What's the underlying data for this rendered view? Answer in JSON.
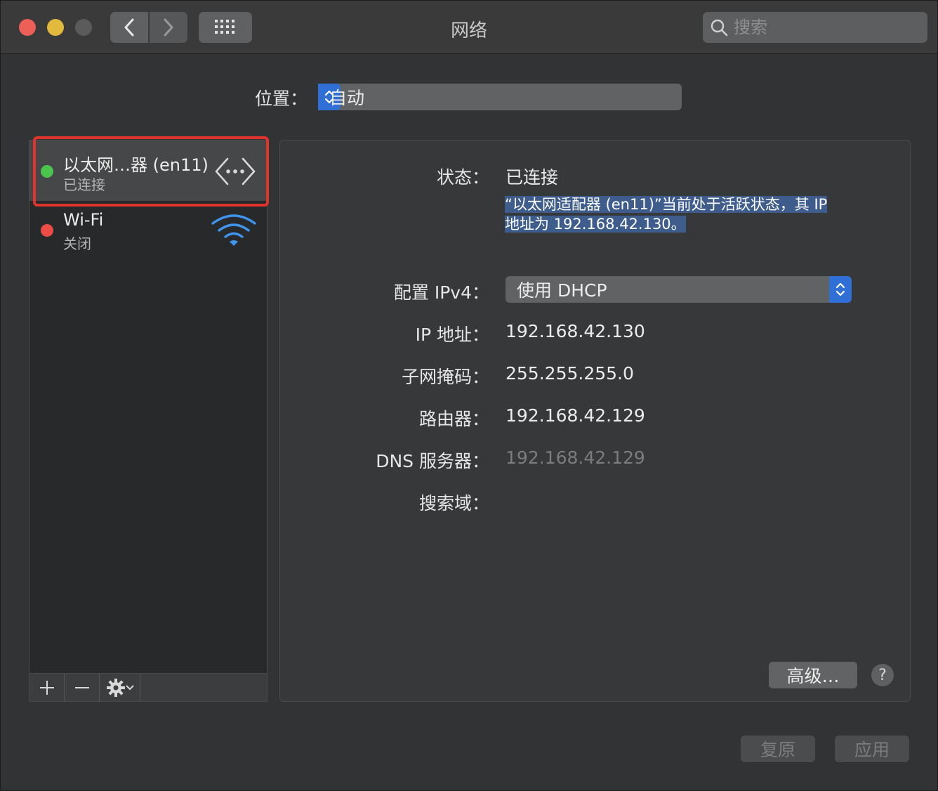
{
  "window": {
    "title": "网络",
    "search_placeholder": "搜索"
  },
  "location": {
    "label": "位置：",
    "value": "自动"
  },
  "services": [
    {
      "name": "以太网…器 (en11)",
      "status": "已连接",
      "dot_color": "#4cc54f",
      "icon": "ethernet-icon"
    },
    {
      "name": "Wi-Fi",
      "status": "关闭",
      "dot_color": "#ec4d47",
      "icon": "wifi-icon"
    }
  ],
  "list_toolbar": {
    "add": "+",
    "remove": "−"
  },
  "detail": {
    "status_label": "状态：",
    "status_value": "已连接",
    "status_desc_line1": "“以太网适配器 (en11)”当前处于活跃状态，其 IP",
    "status_desc_line2": "地址为 192.168.42.130。",
    "config_label": "配置 IPv4：",
    "config_value": "使用 DHCP",
    "ip_label": "IP 地址：",
    "ip_value": "192.168.42.130",
    "subnet_label": "子网掩码：",
    "subnet_value": "255.255.255.0",
    "router_label": "路由器：",
    "router_value": "192.168.42.129",
    "dns_label": "DNS 服务器：",
    "dns_value": "192.168.42.129",
    "search_domain_label": "搜索域：",
    "advanced_button": "高级…",
    "help_button": "?"
  },
  "footer": {
    "revert_button": "复原",
    "apply_button": "应用"
  },
  "colors": {
    "accent": "#2f6fd6",
    "highlight_border": "#e0332c"
  }
}
